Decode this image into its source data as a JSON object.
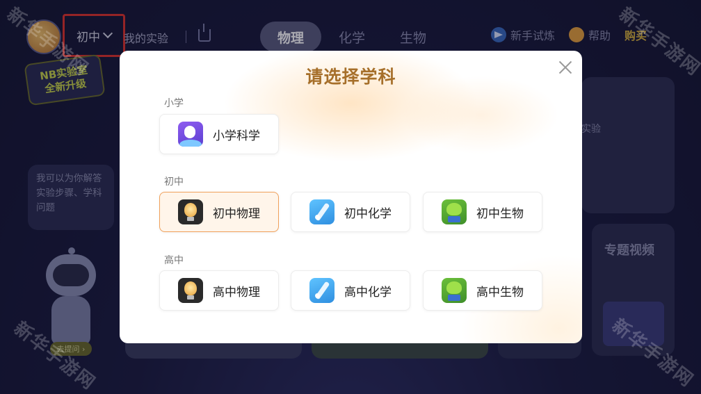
{
  "header": {
    "grade_selector": "初中",
    "my_experiments": "我的实验",
    "subject_tabs": [
      "物理",
      "化学",
      "生物"
    ],
    "newbie_trial": "新手试炼",
    "help": "帮助",
    "buy": "购买"
  },
  "banner": {
    "line1": "NB实验室",
    "line2": "全新升级"
  },
  "assistant": {
    "bubble_text": "我可以为你解答实验步骤、学科问题",
    "ask_button": "去提问 ›"
  },
  "side_cards": {
    "experiment_caption": "实验",
    "topic_video": "专题视频"
  },
  "modal": {
    "title": "请选择学科",
    "sections": [
      {
        "label": "小学",
        "courses": [
          {
            "label": "小学科学",
            "icon": "science-astronaut-icon"
          }
        ]
      },
      {
        "label": "初中",
        "courses": [
          {
            "label": "初中物理",
            "icon": "lightbulb-icon",
            "selected": true
          },
          {
            "label": "初中化学",
            "icon": "dropper-icon"
          },
          {
            "label": "初中生物",
            "icon": "frog-icon"
          }
        ]
      },
      {
        "label": "高中",
        "courses": [
          {
            "label": "高中物理",
            "icon": "lightbulb-icon"
          },
          {
            "label": "高中化学",
            "icon": "dropper-icon"
          },
          {
            "label": "高中生物",
            "icon": "frog-icon"
          }
        ]
      }
    ]
  },
  "watermarks": [
    "新华手游网",
    "新华手游网",
    "新华手游网",
    "新华手游网"
  ],
  "colors": {
    "accent_title": "#a66f2a",
    "selected_border": "#f0a05a",
    "highlight_box": "#e0342b",
    "active_tab_bg": "#5b5c7e"
  }
}
